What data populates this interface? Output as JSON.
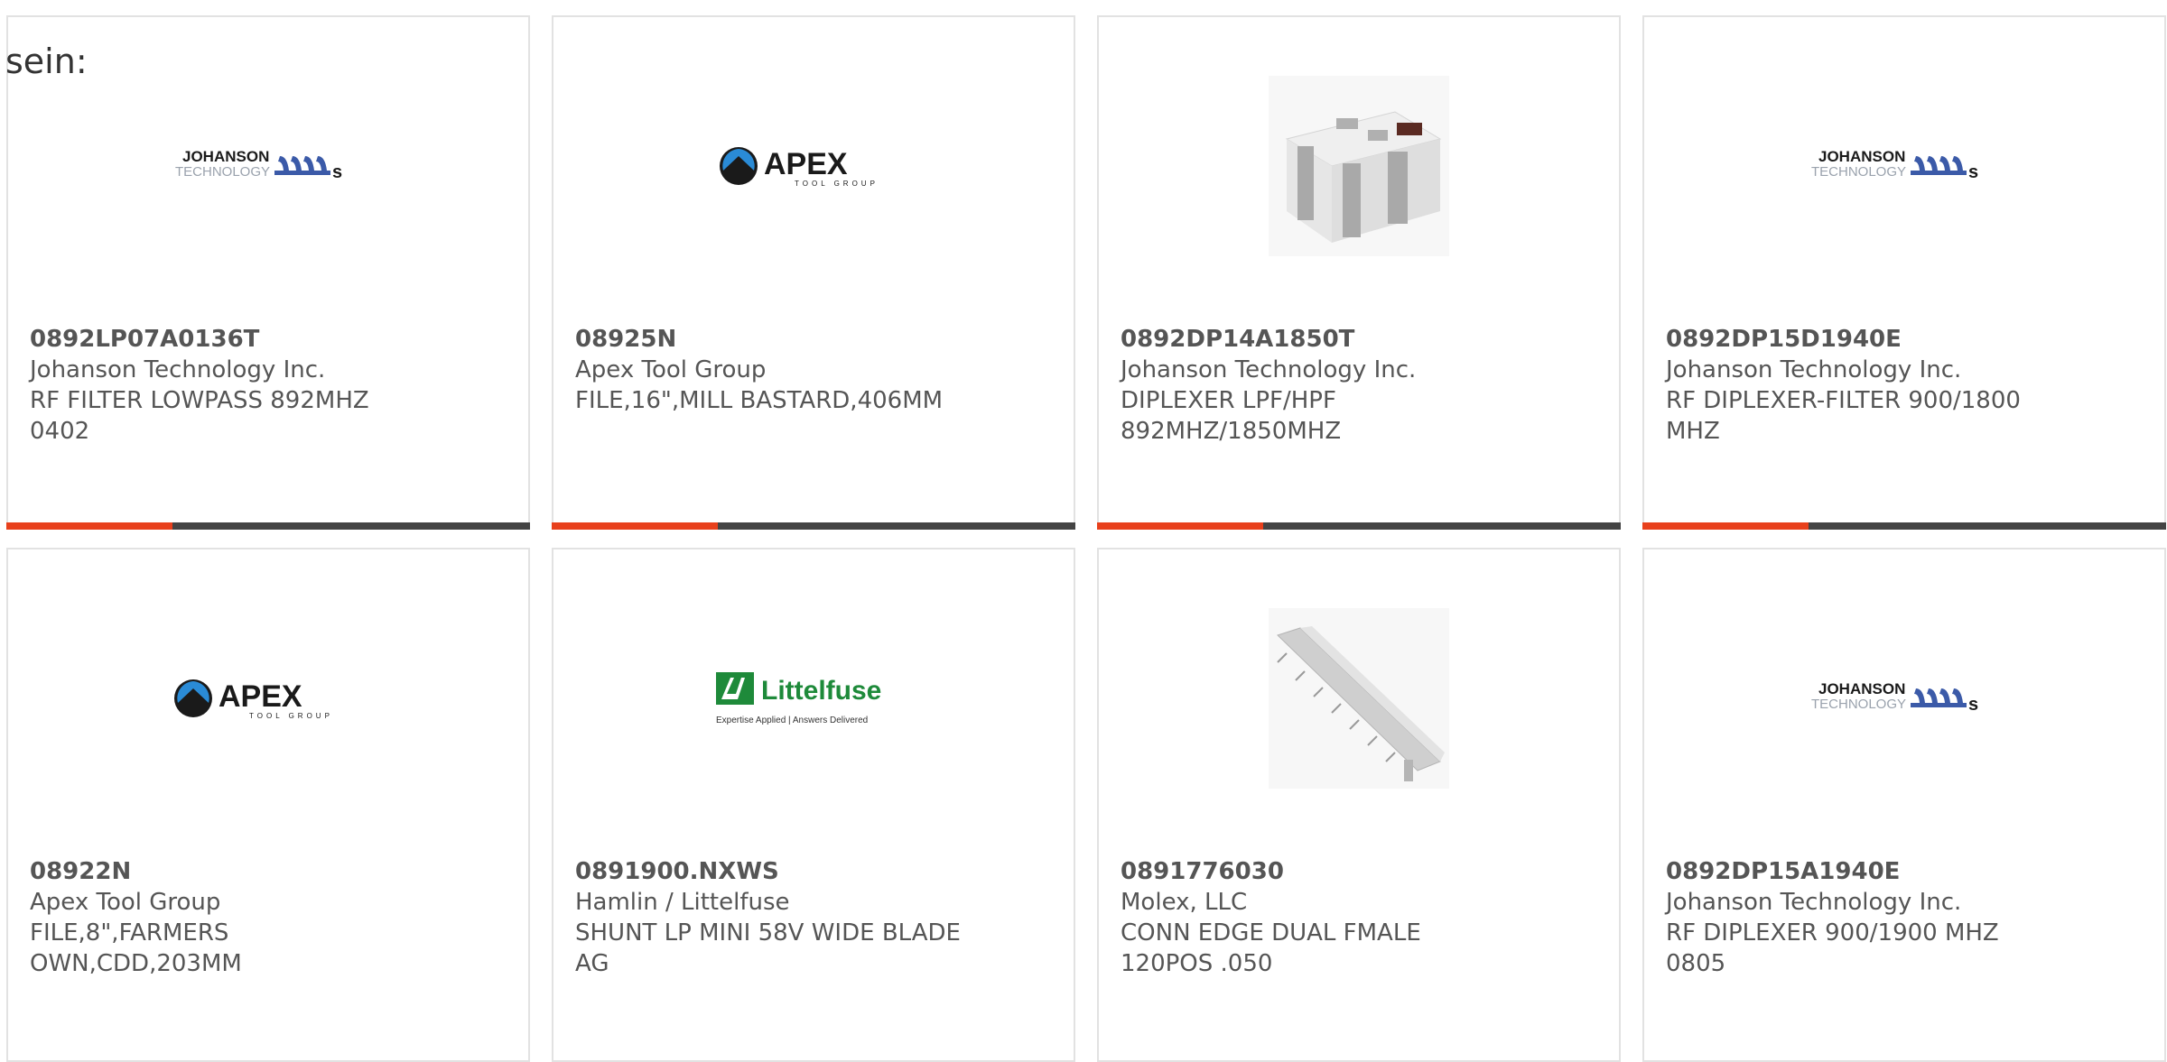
{
  "intro_text": "sein:",
  "colors": {
    "accent": "#e8401c",
    "bar": "#444444",
    "border": "#e2e2e2",
    "text": "#555555"
  },
  "products": [
    {
      "part_number": "0892LP07A0136T",
      "manufacturer": "Johanson Technology Inc.",
      "description": "RF FILTER LOWPASS 892MHZ 0402",
      "image": "johanson-logo",
      "logo": {
        "line1": "JOHANSON",
        "line2": "TECHNOLOGY"
      }
    },
    {
      "part_number": "08925N",
      "manufacturer": "Apex Tool Group",
      "description": "FILE,16\",MILL BASTARD,406MM",
      "image": "apex-logo",
      "logo": {
        "line1": "APEX",
        "line2": "TOOL GROUP"
      }
    },
    {
      "part_number": "0892DP14A1850T",
      "manufacturer": "Johanson Technology Inc.",
      "description": "DIPLEXER LPF/HPF 892MHZ/1850MHZ",
      "image": "ceramic-chip-photo"
    },
    {
      "part_number": "0892DP15D1940E",
      "manufacturer": "Johanson Technology Inc.",
      "description": "RF DIPLEXER-FILTER 900/1800 MHZ",
      "image": "johanson-logo",
      "logo": {
        "line1": "JOHANSON",
        "line2": "TECHNOLOGY"
      }
    },
    {
      "part_number": "08922N",
      "manufacturer": "Apex Tool Group",
      "description": "FILE,8\",FARMERS OWN,CDD,203MM",
      "image": "apex-logo",
      "logo": {
        "line1": "APEX",
        "line2": "TOOL GROUP"
      }
    },
    {
      "part_number": "0891900.NXWS",
      "manufacturer": "Hamlin / Littelfuse",
      "description": "SHUNT LP MINI 58V WIDE BLADE AG",
      "image": "littelfuse-logo",
      "logo": {
        "line1": "Littelfuse",
        "line2": "Expertise Applied | Answers Delivered"
      }
    },
    {
      "part_number": "0891776030",
      "manufacturer": "Molex, LLC",
      "description": "CONN EDGE DUAL FMALE 120POS .050",
      "image": "edge-connector-photo"
    },
    {
      "part_number": "0892DP15A1940E",
      "manufacturer": "Johanson Technology Inc.",
      "description": "RF DIPLEXER 900/1900 MHZ 0805",
      "image": "johanson-logo",
      "logo": {
        "line1": "JOHANSON",
        "line2": "TECHNOLOGY"
      }
    }
  ]
}
